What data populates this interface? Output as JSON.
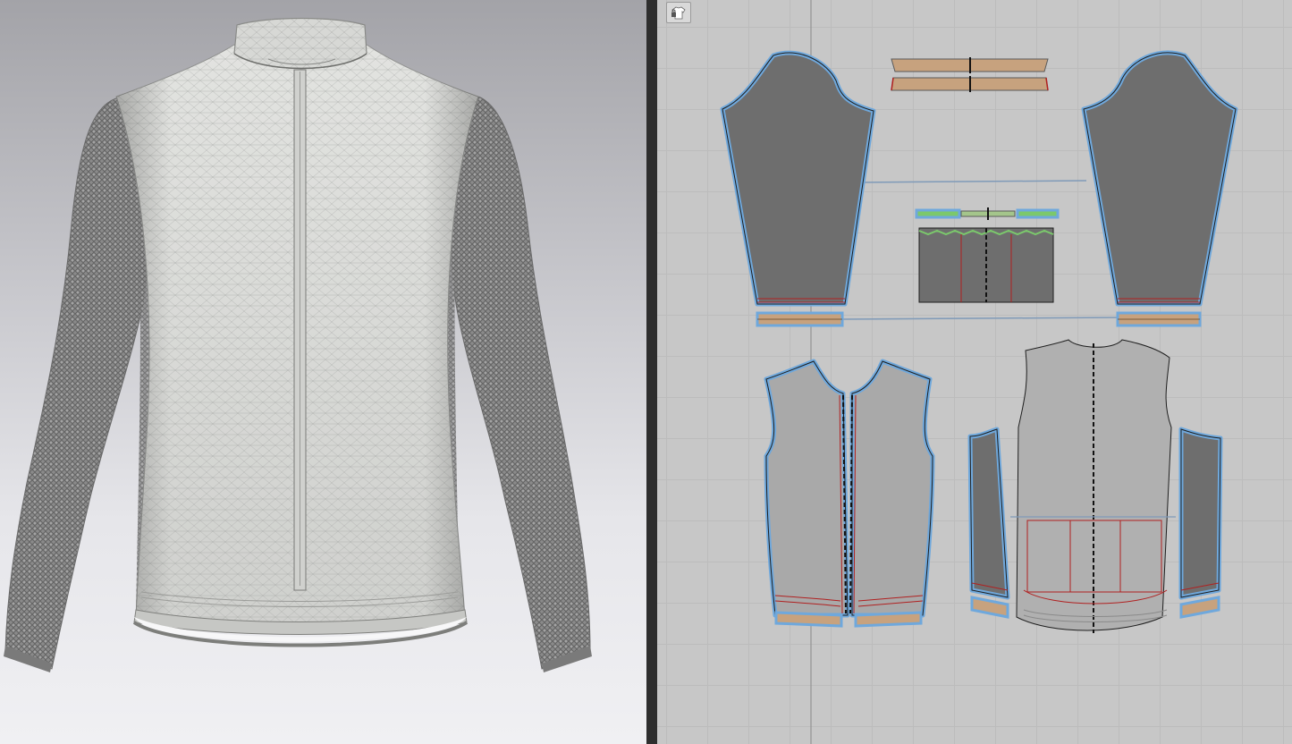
{
  "viewport_3d": {
    "background_top": "#a3a3a8",
    "background_bottom": "#f0f0f3"
  },
  "viewport_2d": {
    "background": "#c7c7c7",
    "grid_color": "#bcbcbc"
  },
  "toolbar": {
    "lock_icon": "lock-shirt-icon"
  },
  "colors": {
    "sleeve_fabric": "#6e6e6e",
    "body_fabric": "#a9a9a9",
    "outline_selected": "#6fa8dc",
    "binding": "#c7a27e",
    "seam_red": "#b02020",
    "ribbing_green": "#7bc86c",
    "link_line": "#7f9ab8"
  },
  "pattern_pieces": [
    "left-sleeve",
    "right-sleeve",
    "collar-band-top",
    "collar-band-bottom",
    "pocket-trim",
    "back-pocket",
    "front-left-panel",
    "front-right-panel",
    "back-panel",
    "left-side-panel",
    "right-side-panel",
    "left-sleeve-cuff",
    "right-sleeve-cuff",
    "front-hem-left",
    "front-hem-right"
  ]
}
